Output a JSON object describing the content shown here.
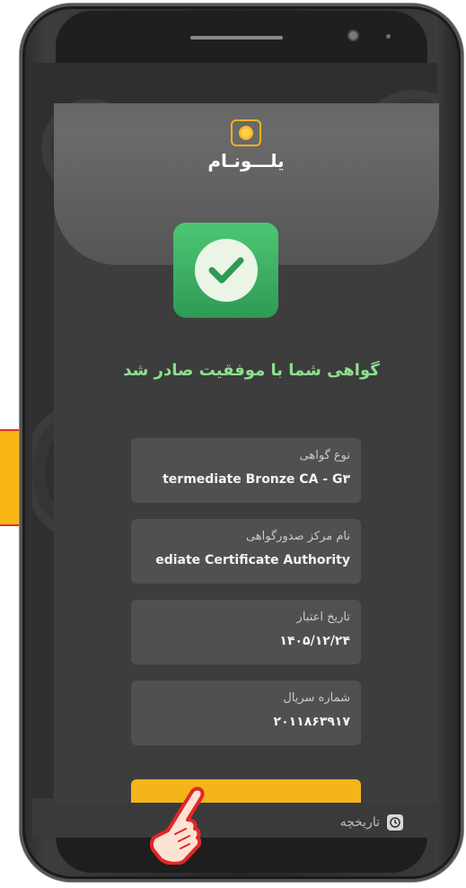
{
  "app": {
    "logo_text": "یلـــونـام"
  },
  "success": {
    "message": "گواهی شما با موفقیت صادر شد"
  },
  "fields": [
    {
      "label": "نوع گواهی",
      "value": "termediate Bronze CA - G۳"
    },
    {
      "label": "نام مرکز صدورگواهی",
      "value": "ediate Certificate Authority"
    },
    {
      "label": "تاریخ اعتبار",
      "value": "۱۴۰۵/۱۲/۲۴"
    },
    {
      "label": "شماره سریال",
      "value": "۲۰۱۱۸۶۳۹۱۷"
    }
  ],
  "bottom_nav": {
    "history_label": "تاریخچه"
  },
  "colors": {
    "accent": "#f6b41b",
    "success": "#3fb465",
    "success_text": "#8ce08f"
  }
}
